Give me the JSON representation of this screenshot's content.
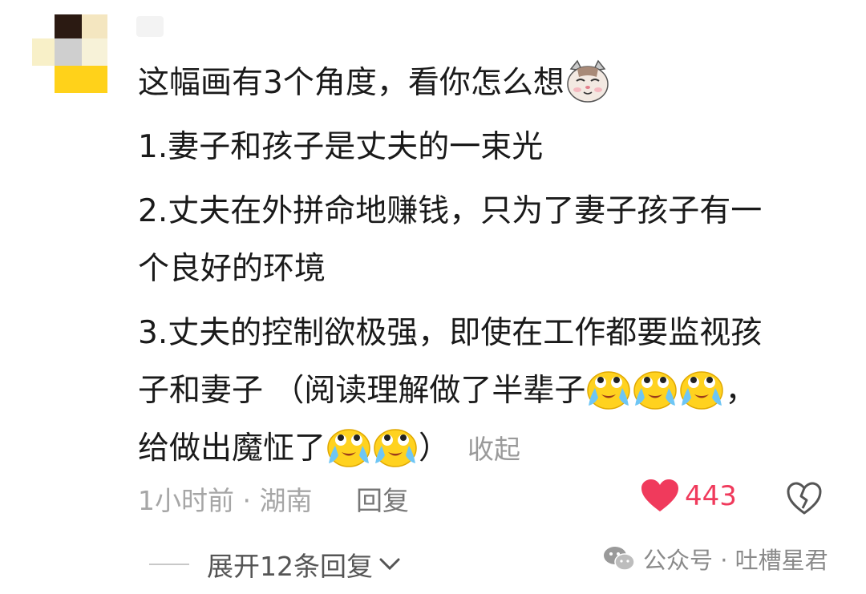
{
  "comment": {
    "line1": "这幅画有3个角度，看你怎么想",
    "line2": "1.妻子和孩子是丈夫的一束光",
    "line3": "2.丈夫在外拼命地赚钱，只为了妻子孩子有一",
    "line4": "个良好的环境",
    "line5": "3.丈夫的控制欲极强，即使在工作都要监视孩",
    "line6": "子和妻子 （阅读理解做了半辈子",
    "line6_tail": "，",
    "line7": "给做出魔怔了",
    "line7_tail": "）",
    "collapse_label": "收起"
  },
  "meta": {
    "time": "1小时前",
    "separator": "·",
    "location": "湖南",
    "reply_label": "回复"
  },
  "like": {
    "count": "443",
    "color": "#f03a5c"
  },
  "expand": {
    "label": "展开12条回复"
  },
  "watermark": {
    "text": "公众号 · 吐槽星君"
  },
  "icons": {
    "cat": "cat-face-icon",
    "cry": "crying-laughing-face-icon",
    "heart": "heart-icon",
    "dislike": "broken-heart-icon",
    "chevron": "chevron-down-icon",
    "wechat": "wechat-icon"
  }
}
